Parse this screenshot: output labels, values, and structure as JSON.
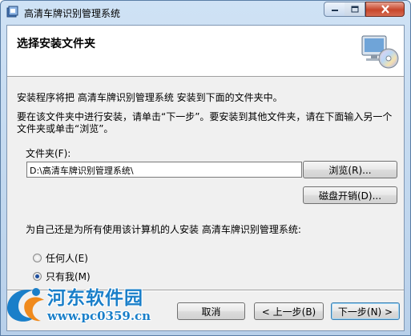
{
  "window": {
    "title": "高清车牌识别管理系统"
  },
  "header": {
    "title": "选择安装文件夹",
    "icon": "setup-disc-computer-icon"
  },
  "body": {
    "paragraph1": "安装程序将把 高清车牌识别管理系统 安装到下面的文件夹中。",
    "paragraph2": "要在该文件夹中进行安装，请单击“下一步”。要安装到其他文件夹，请在下面输入另一个文件夹或单击“浏览”。",
    "folder_label": "文件夹(F):",
    "folder_value": "D:\\高清车牌识别管理系统\\",
    "browse_label": "浏览(R)...",
    "disk_cost_label": "磁盘开销(D)...",
    "question": "为自己还是为所有使用该计算机的人安装 高清车牌识别管理系统:",
    "radio_everyone": "任何人(E)",
    "radio_me": "只有我(M)",
    "selected_option": "只有我(M)"
  },
  "footer": {
    "cancel_label": "取消",
    "back_label": "< 上一步(B)",
    "next_label": "下一步(N) >"
  },
  "watermark": {
    "text1": "河东软件园",
    "text2": "www.pc0359.cn"
  },
  "colors": {
    "frame": "#cfe2f5",
    "close_button": "#c7462b",
    "watermark": "#1a7fc9"
  }
}
